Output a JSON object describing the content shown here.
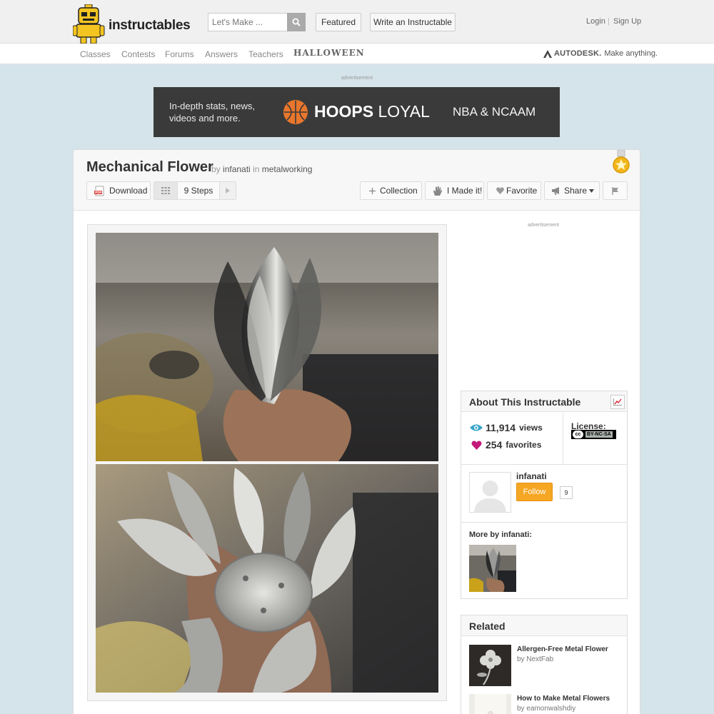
{
  "brand": {
    "name": "instructables"
  },
  "search": {
    "placeholder": "Let's Make ..."
  },
  "header": {
    "featured_label": "Featured",
    "write_label": "Write an Instructable",
    "login_label": "Login",
    "signup_label": "Sign Up"
  },
  "nav": {
    "items": [
      "Classes",
      "Contests",
      "Forums",
      "Answers",
      "Teachers"
    ],
    "special": "HALLOWEEN",
    "autodesk_brand": "AUTODESK.",
    "autodesk_tagline": "Make anything."
  },
  "ad": {
    "label": "advertisement",
    "line1": "In-depth stats, news,",
    "line2": "videos and more.",
    "brand_bold": "HOOPS",
    "brand_rest": "LOYAL",
    "right": "NBA & NCAAM"
  },
  "project": {
    "title": "Mechanical Flower",
    "by": "by",
    "author": "infanati",
    "in": "in",
    "category": "metalworking"
  },
  "toolbar": {
    "download_label": "Download",
    "steps_label": "9 Steps",
    "collection_label": "Collection",
    "made_it_label": "I Made it!",
    "favorite_label": "Favorite",
    "share_label": "Share"
  },
  "sidebar": {
    "ad_label": "advertisement",
    "about": {
      "title": "About This Instructable",
      "views": "11,914",
      "views_label": "views",
      "favorites": "254",
      "favorites_label": "favorites",
      "license_label": "License:",
      "license_badge": "BY-NC-SA",
      "author": "infanati",
      "follow_label": "Follow",
      "follower_count": "9",
      "more_by": "More by infanati:"
    },
    "related": {
      "title": "Related",
      "items": [
        {
          "title": "Allergen-Free Metal Flower",
          "by": "by",
          "author": "NextFab"
        },
        {
          "title": "How to Make Metal Flowers",
          "by": "by",
          "author": "eamonwalshdiy"
        }
      ]
    }
  },
  "colors": {
    "accent": "#f5a623",
    "background": "#d5e3ea",
    "views_icon": "#35a6c7",
    "heart": "#c2187a"
  }
}
